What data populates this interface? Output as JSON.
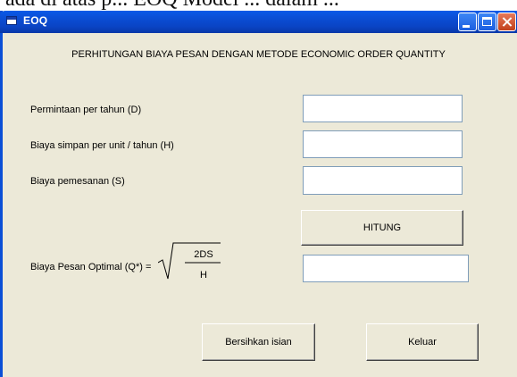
{
  "background_text": "ada di atas p... EOQ Model ... dalam ...",
  "window": {
    "title": "EOQ"
  },
  "heading": "PERHITUNGAN BIAYA PESAN DENGAN METODE ECONOMIC ORDER QUANTITY",
  "fields": [
    {
      "label": "Permintaan per tahun (D)",
      "value": ""
    },
    {
      "label": "Biaya simpan per unit / tahun (H)",
      "value": ""
    },
    {
      "label": "Biaya pemesanan (S)",
      "value": ""
    }
  ],
  "result": {
    "label": "Biaya Pesan Optimal (Q*) =",
    "formula_numerator": "2DS",
    "formula_denominator": "H",
    "value": ""
  },
  "buttons": {
    "hitung": "HITUNG",
    "clear": "Bersihkan isian",
    "exit": "Keluar"
  }
}
